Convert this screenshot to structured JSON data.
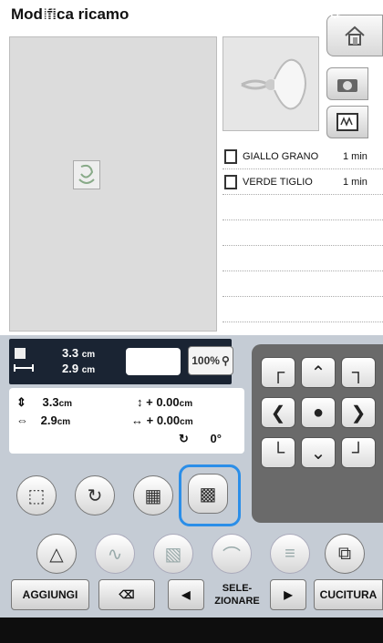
{
  "header": {
    "title": "Modifica ricamo"
  },
  "threads": [
    {
      "name": "GIALLO GRANO",
      "time": "1 min"
    },
    {
      "name": "VERDE TIGLIO",
      "time": "1 min"
    }
  ],
  "size_display": {
    "width": "3.3",
    "height": "2.9",
    "unit": "cm"
  },
  "zoom": "100%",
  "edit_info": {
    "height": "3.3",
    "width": "2.9",
    "unit": "cm",
    "offset_v": "+ 0.00",
    "offset_h": "+ 0.00",
    "rotation": "0°"
  },
  "buttons": {
    "add": "AGGIUNGI",
    "select": "SELE-\nZIONARE",
    "sew": "CUCITURA"
  },
  "toolbar": {
    "help": "?"
  },
  "colors": {
    "panel": "#c5ccd5",
    "highlight": "#2b8ee8",
    "dark": "#1a2433"
  }
}
